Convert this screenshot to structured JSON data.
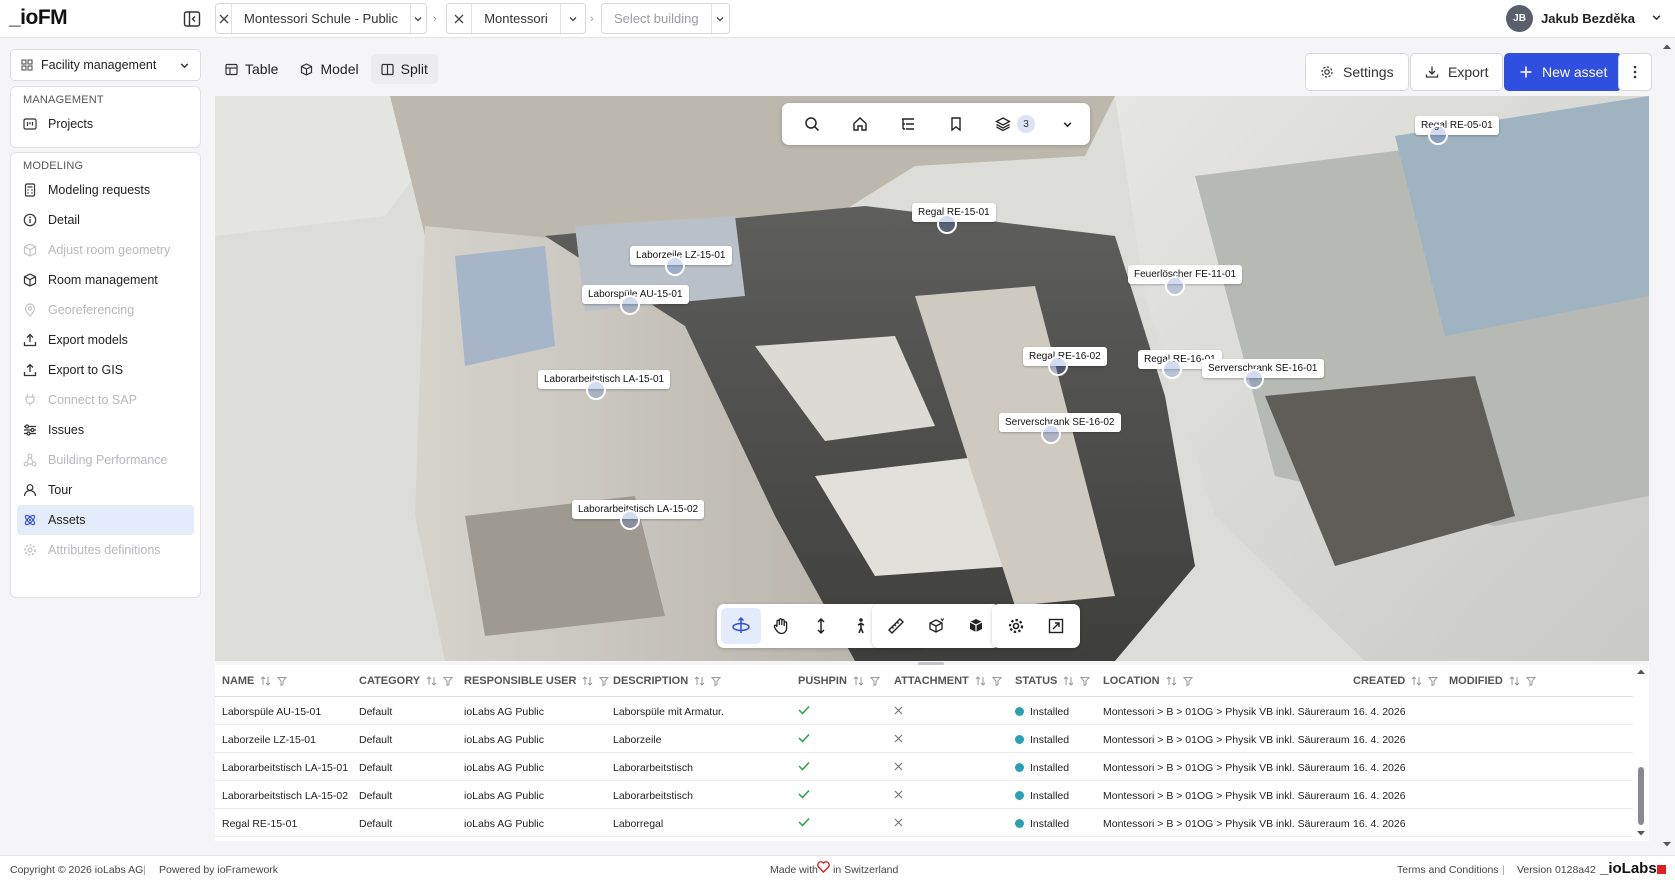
{
  "app": {
    "logo": "_ioFM"
  },
  "breadcrumbs": [
    {
      "label": "Montessori Schule - Public",
      "placeholder": false
    },
    {
      "label": "Montessori",
      "placeholder": false
    },
    {
      "label": "Select building",
      "placeholder": true
    }
  ],
  "breadcrumb_separator": "›",
  "user": {
    "initials": "JB",
    "name": "Jakub Bezděka"
  },
  "module_select": {
    "label": "Facility management"
  },
  "sidebar": {
    "management_heading": "MANAGEMENT",
    "management_items": [
      {
        "label": "Projects",
        "icon": "folder-kanban-icon"
      }
    ],
    "modeling_heading": "MODELING",
    "modeling_items": [
      {
        "label": "Modeling requests",
        "icon": "calculator-icon",
        "disabled": false,
        "active": false
      },
      {
        "label": "Detail",
        "icon": "info-icon",
        "disabled": false,
        "active": false
      },
      {
        "label": "Adjust room geometry",
        "icon": "box-icon",
        "disabled": true,
        "active": false
      },
      {
        "label": "Room management",
        "icon": "box-icon",
        "disabled": false,
        "active": false
      },
      {
        "label": "Georeferencing",
        "icon": "map-pin-icon",
        "disabled": true,
        "active": false
      },
      {
        "label": "Export models",
        "icon": "upload-icon",
        "disabled": false,
        "active": false
      },
      {
        "label": "Export to GIS",
        "icon": "upload-icon",
        "disabled": false,
        "active": false
      },
      {
        "label": "Connect to SAP",
        "icon": "plug-icon",
        "disabled": true,
        "active": false
      },
      {
        "label": "Issues",
        "icon": "sliders-icon",
        "disabled": false,
        "active": false
      },
      {
        "label": "Building Performance",
        "icon": "network-icon",
        "disabled": true,
        "active": false
      },
      {
        "label": "Tour",
        "icon": "user-icon",
        "disabled": false,
        "active": false
      },
      {
        "label": "Assets",
        "icon": "atom-icon",
        "disabled": false,
        "active": true
      },
      {
        "label": "Attributes definitions",
        "icon": "gear-icon",
        "disabled": true,
        "active": false
      }
    ]
  },
  "view_tabs": [
    {
      "label": "Table",
      "icon": "table-icon",
      "active": false
    },
    {
      "label": "Model",
      "icon": "cube-icon",
      "active": false
    },
    {
      "label": "Split",
      "icon": "columns-icon",
      "active": true
    }
  ],
  "actions": {
    "settings": "Settings",
    "export": "Export",
    "new_asset": "New asset"
  },
  "viewer": {
    "layers_count": "3",
    "pins": [
      {
        "label": "Regal RE-05-01"
      },
      {
        "label": "Regal RE-15-01"
      },
      {
        "label": "Laborzeile LZ-15-01"
      },
      {
        "label": "Laborspüle AU-15-01"
      },
      {
        "label": "Feuerlöscher FE-11-01"
      },
      {
        "label": "Laborarbeitstisch LA-15-01"
      },
      {
        "label": "Regal RE-16-02"
      },
      {
        "label": "Regal RE-16-01"
      },
      {
        "label": "Serverschrank SE-16-01"
      },
      {
        "label": "Serverschrank SE-16-02"
      },
      {
        "label": "Laborarbeitstisch LA-15-02"
      }
    ]
  },
  "table": {
    "columns": [
      "NAME",
      "CATEGORY",
      "RESPONSIBLE USER",
      "DESCRIPTION",
      "PUSHPIN",
      "ATTACHMENT",
      "STATUS",
      "LOCATION",
      "CREATED",
      "MODIFIED"
    ],
    "rows": [
      {
        "name": "Laborspüle AU-15-01",
        "category": "Default",
        "user": "ioLabs AG Public",
        "description": "Laborspüle mit Armatur.",
        "pushpin": true,
        "attachment": false,
        "status": "Installed",
        "location": "Montessori > B > 01OG > Physik VB inkl. Säureraum",
        "created": "16. 4. 2026",
        "modified": ""
      },
      {
        "name": "Laborzeile LZ-15-01",
        "category": "Default",
        "user": "ioLabs AG Public",
        "description": "Laborzeile",
        "pushpin": true,
        "attachment": false,
        "status": "Installed",
        "location": "Montessori > B > 01OG > Physik VB inkl. Säureraum",
        "created": "16. 4. 2026",
        "modified": ""
      },
      {
        "name": "Laborarbeitstisch LA-15-01",
        "category": "Default",
        "user": "ioLabs AG Public",
        "description": "Laborarbeitstisch",
        "pushpin": true,
        "attachment": false,
        "status": "Installed",
        "location": "Montessori > B > 01OG > Physik VB inkl. Säureraum",
        "created": "16. 4. 2026",
        "modified": ""
      },
      {
        "name": "Laborarbeitstisch LA-15-02",
        "category": "Default",
        "user": "ioLabs AG Public",
        "description": "Laborarbeitstisch",
        "pushpin": true,
        "attachment": false,
        "status": "Installed",
        "location": "Montessori > B > 01OG > Physik VB inkl. Säureraum",
        "created": "16. 4. 2026",
        "modified": ""
      },
      {
        "name": "Regal RE-15-01",
        "category": "Default",
        "user": "ioLabs AG Public",
        "description": "Laborregal",
        "pushpin": true,
        "attachment": false,
        "status": "Installed",
        "location": "Montessori > B > 01OG > Physik VB inkl. Säureraum",
        "created": "16. 4. 2026",
        "modified": ""
      }
    ]
  },
  "footer": {
    "copyright": "Copyright © 2026 ioLabs AG",
    "separator": "|",
    "powered": "Powered by ioFramework",
    "made_with": "Made with",
    "in_switzerland": "in Switzerland",
    "terms": "Terms and Conditions",
    "version": "Version 0128a42",
    "brand": "_ioLabs"
  },
  "colors": {
    "primary": "#2f4fe0",
    "active_bg": "#e4ebfb",
    "status_installed": "#2aa0b8",
    "check": "#2e9e4f",
    "heart": "#e02020"
  }
}
